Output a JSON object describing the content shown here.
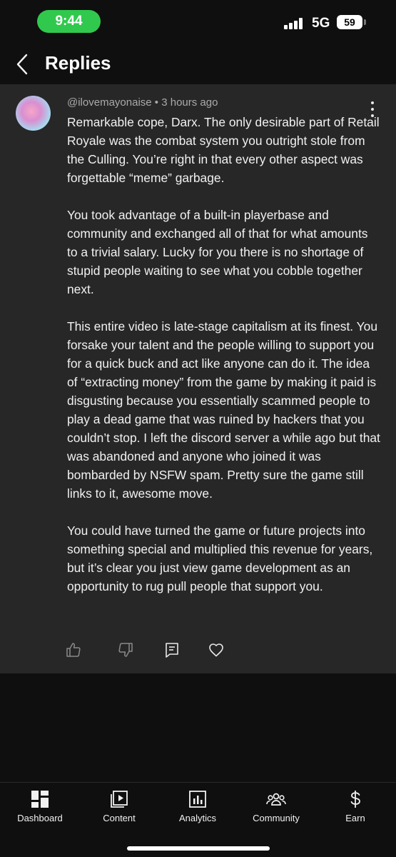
{
  "status_bar": {
    "time": "9:44",
    "network": "5G",
    "battery": "59",
    "time_pill_color": "#30c94d"
  },
  "header": {
    "title": "Replies"
  },
  "comment": {
    "author": "@ilovemayonaise",
    "separator": "•",
    "timestamp": "3 hours ago",
    "paragraphs": [
      "Remarkable cope, Darx.  The only desirable part of Retail Royale was the combat system you outright stole from the Culling.  You’re right in that every other aspect was forgettable “meme” garbage.",
      "You took advantage of a built-in playerbase and community and exchanged all of that for what amounts to a trivial salary.  Lucky for you there is no shortage of stupid people waiting to see what you cobble together next.",
      "This entire video is late-stage capitalism at its finest.  You forsake your talent and the people willing to support you for a quick buck and act like anyone can do it.  The idea of “extracting money” from the game by making it paid is disgusting because you essentially scammed people to play a dead game that was ruined by hackers that you couldn’t stop.  I left the discord server a while ago but that was abandoned and anyone who joined it was bombarded by NSFW spam.  Pretty sure the game still links to it, awesome move.",
      "You could have turned the game or future projects into something special and multiplied this revenue for years, but it’s clear you just view game development as an opportunity to rug pull people that support you."
    ],
    "actions": [
      "thumbs-up-icon",
      "thumbs-down-icon",
      "reply-icon",
      "heart-icon"
    ]
  },
  "bottom_nav": {
    "items": [
      {
        "label": "Dashboard",
        "icon": "dashboard-icon"
      },
      {
        "label": "Content",
        "icon": "content-icon"
      },
      {
        "label": "Analytics",
        "icon": "analytics-icon"
      },
      {
        "label": "Community",
        "icon": "community-icon"
      },
      {
        "label": "Earn",
        "icon": "earn-icon"
      }
    ]
  }
}
